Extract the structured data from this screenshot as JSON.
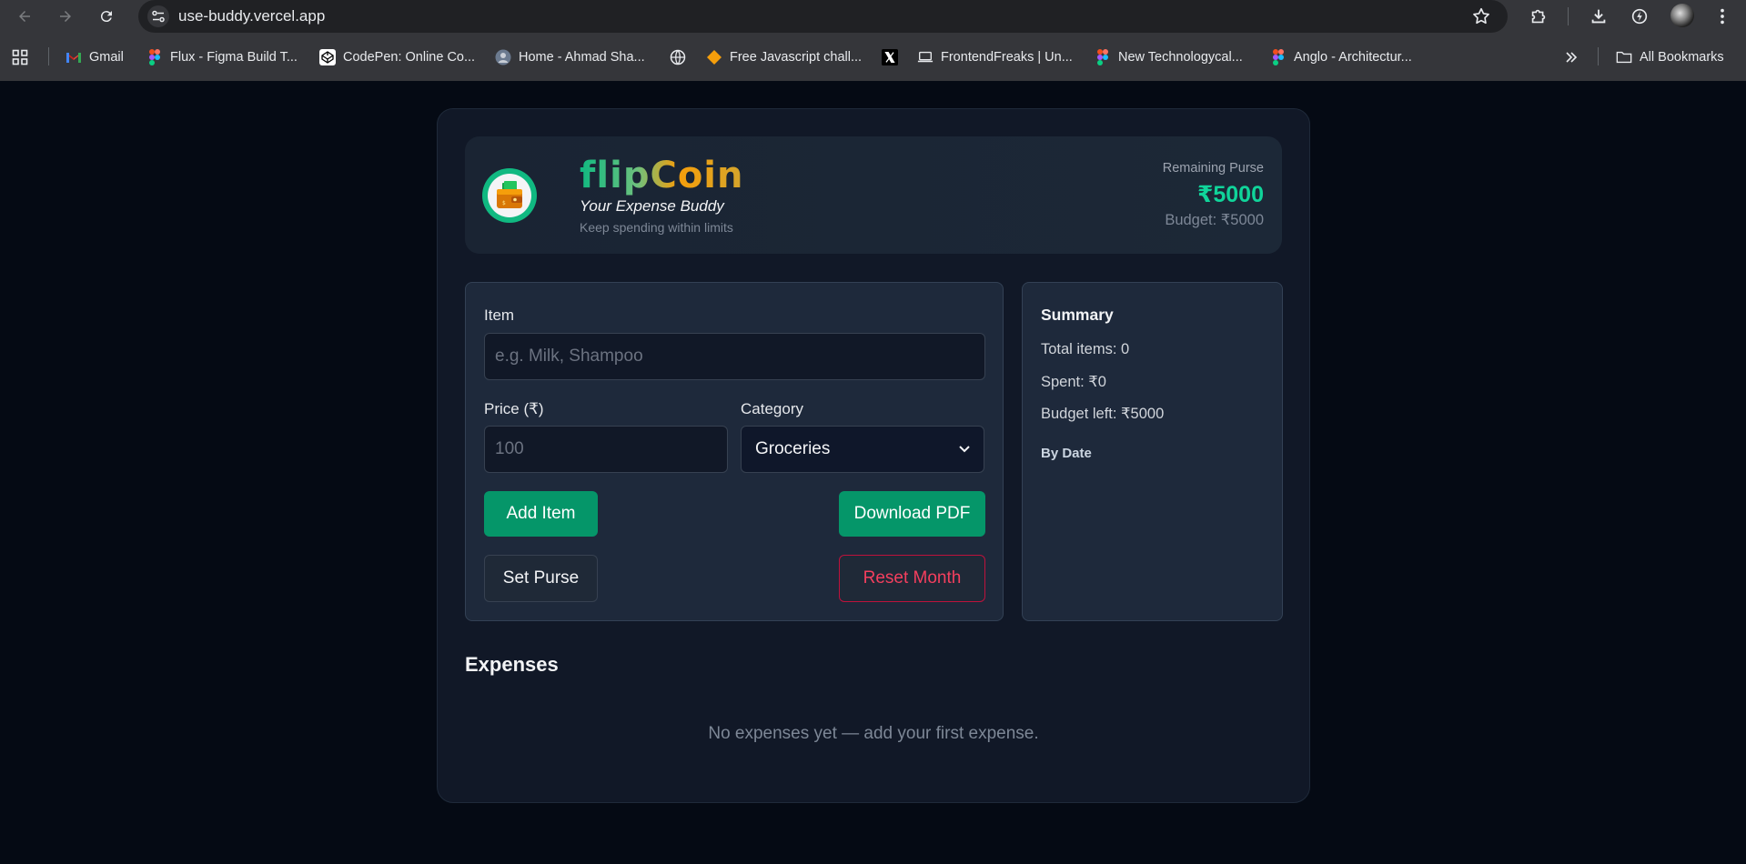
{
  "browser": {
    "url": "use-buddy.vercel.app",
    "bookmarks": [
      {
        "label": "Gmail",
        "icon": "gmail-icon"
      },
      {
        "label": "Flux - Figma Build T...",
        "icon": "figma-icon"
      },
      {
        "label": "CodePen: Online Co...",
        "icon": "codepen-icon"
      },
      {
        "label": "Home - Ahmad Sha...",
        "icon": "globe-avatar-icon"
      },
      {
        "label": "",
        "icon": "globe-icon"
      },
      {
        "label": "Free Javascript chall...",
        "icon": "diamond-icon"
      },
      {
        "label": "",
        "icon": "x-icon"
      },
      {
        "label": "FrontendFreaks | Un...",
        "icon": "laptop-icon"
      },
      {
        "label": "New Technologycal...",
        "icon": "figma-icon"
      },
      {
        "label": "Anglo - Architectur...",
        "icon": "figma-icon"
      }
    ],
    "all_bookmarks_label": "All Bookmarks"
  },
  "app": {
    "brand": "flipCoin",
    "tagline": "Your Expense Buddy",
    "subtagline": "Keep spending within limits",
    "purse_label": "Remaining Purse",
    "purse_value": "₹5000",
    "budget_text": "Budget: ₹5000",
    "form": {
      "item_label": "Item",
      "item_placeholder": "e.g. Milk, Shampoo",
      "price_label": "Price (₹)",
      "price_placeholder": "100",
      "category_label": "Category",
      "category_selected": "Groceries",
      "add_button": "Add Item",
      "download_button": "Download PDF",
      "set_purse_button": "Set Purse",
      "reset_button": "Reset Month"
    },
    "summary": {
      "title": "Summary",
      "total_items": "Total items: 0",
      "spent": "Spent: ₹0",
      "budget_left": "Budget left: ₹5000",
      "by_date": "By Date"
    },
    "expenses_title": "Expenses",
    "empty_message": "No expenses yet — add your first expense."
  },
  "colors": {
    "accent_green": "#059669",
    "purse_green": "#10d49a",
    "danger": "#f43f5e",
    "page_bg": "#050a14"
  }
}
